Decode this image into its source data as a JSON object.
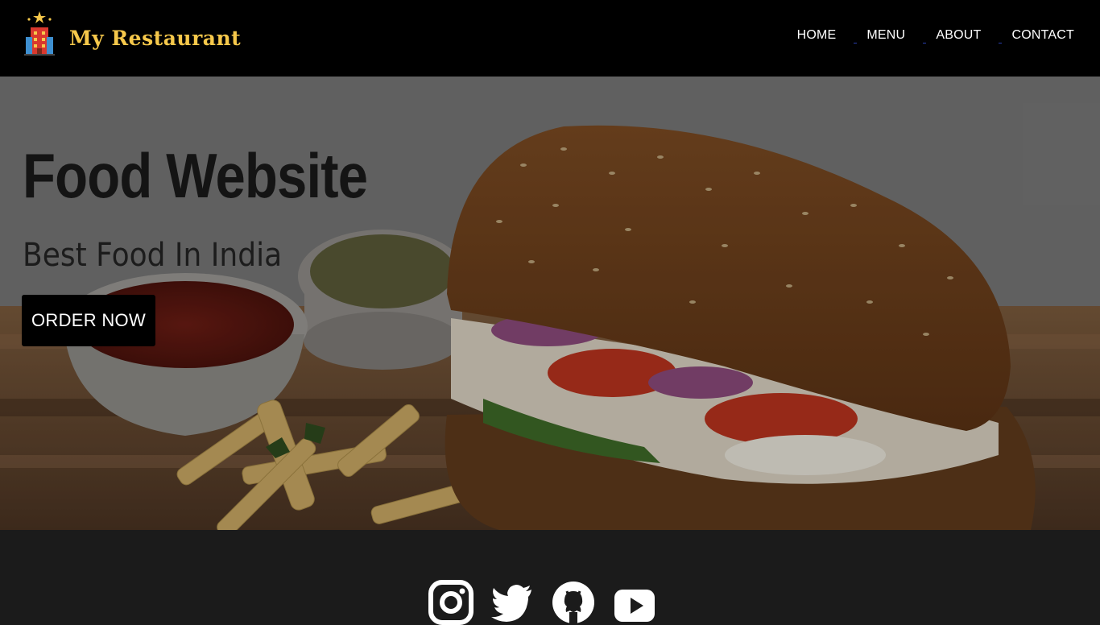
{
  "brand": {
    "name": "My Restaurant"
  },
  "nav": {
    "items": [
      {
        "label": "HOME"
      },
      {
        "label": "MENU"
      },
      {
        "label": "ABOUT"
      },
      {
        "label": "CONTACT"
      }
    ]
  },
  "hero": {
    "title": "Food Website",
    "subtitle": "Best Food In India",
    "cta_label": "ORDER NOW"
  },
  "footer": {
    "social_icons": [
      "instagram-icon",
      "twitter-icon",
      "github-icon",
      "youtube-icon"
    ]
  },
  "colors": {
    "header_bg": "#000000",
    "brand_text": "#f6c84b",
    "footer_bg": "#1b1b1b",
    "button_bg": "#000000"
  }
}
